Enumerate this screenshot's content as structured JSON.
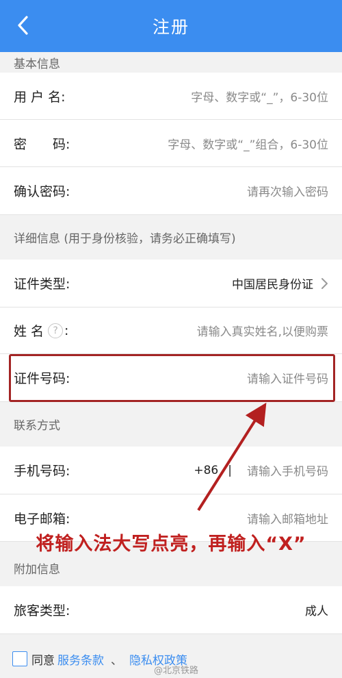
{
  "header": {
    "title": "注册",
    "back_icon": "chevron-left-icon",
    "bg_color": "#3b8df0"
  },
  "sections": {
    "basic": {
      "title": "基本信息",
      "username": {
        "label": "用 户 名:",
        "placeholder": "字母、数字或“_”，6-30位"
      },
      "password": {
        "label": "密　　码:",
        "placeholder": "字母、数字或“_”组合，6-30位"
      },
      "confirm": {
        "label": "确认密码:",
        "placeholder": "请再次输入密码"
      }
    },
    "detail": {
      "title": "详细信息 (用于身份核验，请务必正确填写)",
      "id_type": {
        "label": "证件类型:",
        "value": "中国居民身份证"
      },
      "name": {
        "label": "姓 名",
        "label_suffix": ":",
        "help": "?",
        "placeholder": "请输入真实姓名,以便购票"
      },
      "id_number": {
        "label": "证件号码:",
        "placeholder": "请输入证件号码"
      }
    },
    "contact": {
      "title": "联系方式",
      "phone": {
        "label": "手机号码:",
        "prefix": "+86",
        "divider": "|",
        "placeholder": "请输入手机号码"
      },
      "email": {
        "label": "电子邮箱:",
        "placeholder": "请输入邮箱地址"
      }
    },
    "extra": {
      "title": "附加信息",
      "passenger_type": {
        "label": "旅客类型:",
        "value": "成人"
      }
    }
  },
  "annotation": {
    "text": "将输入法大写点亮，再输入“X”",
    "color": "#c0201f"
  },
  "agreement": {
    "text": "同意",
    "terms": "服务条款",
    "separator": "、",
    "privacy": "隐私权政策"
  },
  "watermark": "@北京铁路"
}
